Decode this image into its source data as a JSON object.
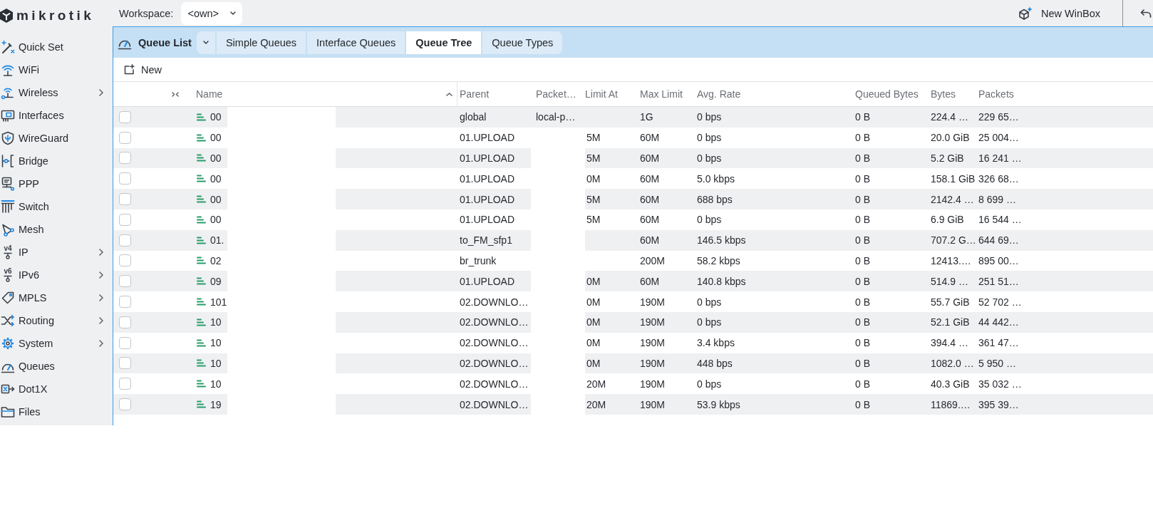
{
  "sidebar": {
    "logo": "mikrotik",
    "items": [
      {
        "label": "Quick Set",
        "submenu": false
      },
      {
        "label": "WiFi",
        "submenu": false
      },
      {
        "label": "Wireless",
        "submenu": true
      },
      {
        "label": "Interfaces",
        "submenu": false
      },
      {
        "label": "WireGuard",
        "submenu": false
      },
      {
        "label": "Bridge",
        "submenu": false
      },
      {
        "label": "PPP",
        "submenu": false
      },
      {
        "label": "Switch",
        "submenu": false
      },
      {
        "label": "Mesh",
        "submenu": false
      },
      {
        "label": "IP",
        "submenu": true,
        "icon_text": "v4"
      },
      {
        "label": "IPv6",
        "submenu": true,
        "icon_text": "v6"
      },
      {
        "label": "MPLS",
        "submenu": true
      },
      {
        "label": "Routing",
        "submenu": true
      },
      {
        "label": "System",
        "submenu": true
      },
      {
        "label": "Queues",
        "submenu": false
      },
      {
        "label": "Dot1X",
        "submenu": false
      },
      {
        "label": "Files",
        "submenu": false
      }
    ]
  },
  "top_bar": {
    "workspace": {
      "label": "Workspace:",
      "value": "<own>"
    },
    "new_winbox_button": "New WinBox"
  },
  "queue_window": {
    "title": "Queue List",
    "tabs": [
      {
        "label": "Simple Queues",
        "selected": false
      },
      {
        "label": "Interface Queues",
        "selected": false
      },
      {
        "label": "Queue Tree",
        "selected": true
      },
      {
        "label": "Queue Types",
        "selected": false
      }
    ],
    "toolbar": {
      "new_button": "New"
    },
    "table": {
      "columns": [
        {
          "label": "Name",
          "sorted": true
        },
        {
          "label": "Parent"
        },
        {
          "label": "Packet…"
        },
        {
          "label": "Limit At"
        },
        {
          "label": "Max Limit"
        },
        {
          "label": "Avg. Rate"
        },
        {
          "label": "Queued Bytes"
        },
        {
          "label": "Bytes"
        },
        {
          "label": "Packets"
        }
      ],
      "rows": [
        {
          "checked": false,
          "name": "00",
          "parent": "global",
          "column_3": "local-p…",
          "max_limit": "1G",
          "avg_rate": "0 bps",
          "queued_bytes": "0 B",
          "bytes": "224.4 …",
          "packets": "229 65…"
        },
        {
          "checked": false,
          "name": "00",
          "parent": "01.UPLOAD",
          "limit_at": "5M",
          "max_limit": "60M",
          "avg_rate": "0 bps",
          "queued_bytes": "0 B",
          "bytes": "20.0 GiB",
          "packets": "25 004…"
        },
        {
          "checked": false,
          "name": "00",
          "parent": "01.UPLOAD",
          "limit_at": "5M",
          "max_limit": "60M",
          "avg_rate": "0 bps",
          "queued_bytes": "0 B",
          "bytes": "5.2 GiB",
          "packets": "16 241 …"
        },
        {
          "checked": false,
          "name": "00",
          "parent": "01.UPLOAD",
          "limit_at": "0M",
          "max_limit": "60M",
          "avg_rate": "5.0 kbps",
          "queued_bytes": "0 B",
          "bytes": "158.1 GiB",
          "packets": "326 68…"
        },
        {
          "checked": false,
          "name": "00",
          "parent": "01.UPLOAD",
          "limit_at": "5M",
          "max_limit": "60M",
          "avg_rate": "688 bps",
          "queued_bytes": "0 B",
          "bytes": "2142.4 …",
          "packets": "8 699 …"
        },
        {
          "checked": false,
          "name": "00",
          "parent": "01.UPLOAD",
          "limit_at": "5M",
          "max_limit": "60M",
          "avg_rate": "0 bps",
          "queued_bytes": "0 B",
          "bytes": "6.9 GiB",
          "packets": "16 544 …"
        },
        {
          "checked": false,
          "name": "01.",
          "parent": "to_FM_sfp1",
          "max_limit": "60M",
          "avg_rate": "146.5 kbps",
          "queued_bytes": "0 B",
          "bytes": "707.2 G…",
          "packets": "644 69…"
        },
        {
          "checked": false,
          "name": "02",
          "parent": "br_trunk",
          "max_limit": "200M",
          "avg_rate": "58.2 kbps",
          "queued_bytes": "0 B",
          "bytes": "12413.…",
          "packets": "895 00…"
        },
        {
          "checked": false,
          "name": "09",
          "parent": "01.UPLOAD",
          "limit_at": "0M",
          "max_limit": "60M",
          "avg_rate": "140.8 kbps",
          "queued_bytes": "0 B",
          "bytes": "514.9 …",
          "packets": "251 51…"
        },
        {
          "checked": false,
          "name": "101",
          "parent": "02.DOWNLO…",
          "limit_at": "0M",
          "max_limit": "190M",
          "avg_rate": "0 bps",
          "queued_bytes": "0 B",
          "bytes": "55.7 GiB",
          "packets": "52 702 …"
        },
        {
          "checked": false,
          "name": "10",
          "parent": "02.DOWNLO…",
          "limit_at": "0M",
          "max_limit": "190M",
          "avg_rate": "0 bps",
          "queued_bytes": "0 B",
          "bytes": "52.1 GiB",
          "packets": "44 442…"
        },
        {
          "checked": false,
          "name": "10",
          "parent": "02.DOWNLO…",
          "limit_at": "0M",
          "max_limit": "190M",
          "avg_rate": "3.4 kbps",
          "queued_bytes": "0 B",
          "bytes": "394.4 …",
          "packets": "361 47…"
        },
        {
          "checked": false,
          "name": "10",
          "parent": "02.DOWNLO…",
          "limit_at": "0M",
          "max_limit": "190M",
          "avg_rate": "448 bps",
          "queued_bytes": "0 B",
          "bytes": "1082.0 …",
          "packets": "5 950 …"
        },
        {
          "checked": false,
          "name": "10",
          "parent": "02.DOWNLO…",
          "limit_at": "20M",
          "max_limit": "190M",
          "avg_rate": "0 bps",
          "queued_bytes": "0 B",
          "bytes": "40.3 GiB",
          "packets": "35 032 …"
        },
        {
          "checked": false,
          "name": "19",
          "parent": "02.DOWNLO…",
          "limit_at": "20M",
          "max_limit": "190M",
          "avg_rate": "53.9 kbps",
          "queued_bytes": "0 B",
          "bytes": "11869.…",
          "packets": "395 39…"
        }
      ]
    }
  }
}
